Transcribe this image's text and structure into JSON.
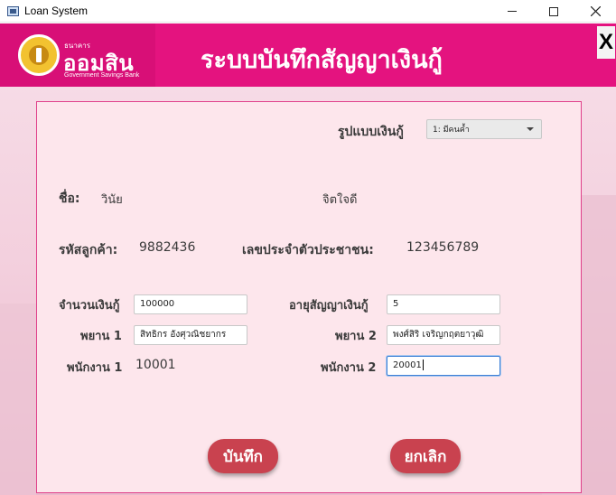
{
  "window": {
    "title": "Loan System"
  },
  "header": {
    "logo_small": "ธนาคาร",
    "logo_main": "ออมสิน",
    "logo_sub": "Government Savings Bank",
    "title": "ระบบบันทึกสัญญาเงินกู้",
    "close_label": "X"
  },
  "form": {
    "loan_type": {
      "label": "รูปแบบเงินกู้",
      "selected": "1: มีคนค้ำ"
    },
    "name": {
      "label": "ชื่อ:",
      "first": "วินัย",
      "last": "จิตใจดี"
    },
    "customer_id": {
      "label": "รหัสลูกค้า:",
      "value": "9882436"
    },
    "citizen_id": {
      "label": "เลขประจำตัวประชาชน:",
      "value": "123456789"
    },
    "loan_amount": {
      "label": "จำนวนเงินกู้",
      "value": "100000"
    },
    "loan_term": {
      "label": "อายุสัญญาเงินกู้",
      "value": "5"
    },
    "witness1": {
      "label": "พยาน 1",
      "value": "สิทธิกร อังศุวณิชยากร"
    },
    "witness2": {
      "label": "พยาน 2",
      "value": "พงศ์สิริ เจริญกฤตยาวุฒิ"
    },
    "employee1": {
      "label": "พนักงาน 1",
      "value": "10001"
    },
    "employee2": {
      "label": "พนักงาน 2",
      "value": "20001"
    },
    "save_label": "บันทึก",
    "cancel_label": "ยกเลิก"
  },
  "colors": {
    "brand_pink": "#e4137f",
    "panel_bg": "#fde6ec",
    "button_red": "#c9424f"
  }
}
